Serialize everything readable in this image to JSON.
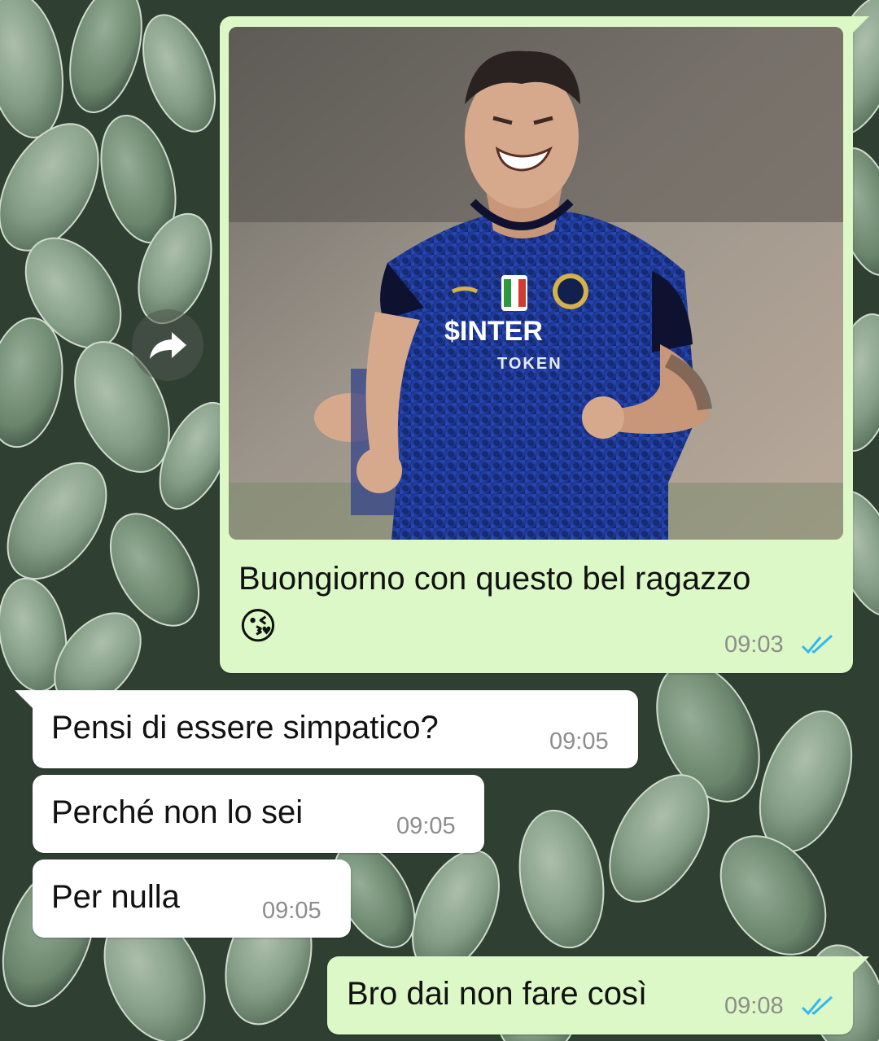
{
  "colors": {
    "outgoing_bubble": "#dcf8c6",
    "incoming_bubble": "#ffffff",
    "read_ticks": "#34b7f1",
    "timestamp": "#8d8d8d"
  },
  "messages": [
    {
      "direction": "outgoing",
      "has_image": true,
      "image_description_icon": "photo-of-football-player-icon",
      "jersey_text": "$INTER",
      "text": "Buongiorno con questo bel ragazzo",
      "emoji": "😘",
      "time": "09:03",
      "status": "read"
    },
    {
      "direction": "incoming",
      "text": "Pensi di essere simpatico?",
      "time": "09:05"
    },
    {
      "direction": "incoming",
      "text": "Perché non lo sei",
      "time": "09:05"
    },
    {
      "direction": "incoming",
      "text": "Per nulla",
      "time": "09:05"
    },
    {
      "direction": "outgoing",
      "text": "Bro dai non fare così",
      "time": "09:08",
      "status": "read"
    }
  ],
  "forward_icon": "forward-icon"
}
